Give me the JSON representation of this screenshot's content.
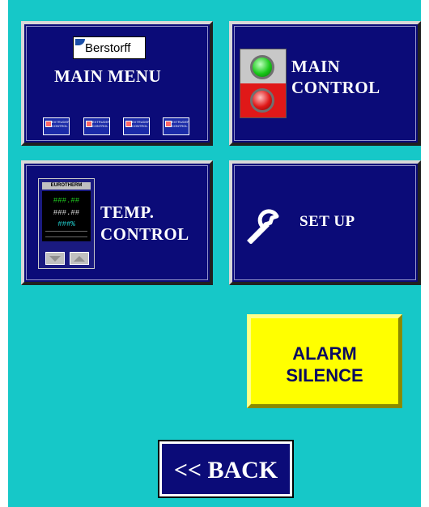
{
  "main_menu": {
    "label": "MAIN MENU",
    "logo_text": "Berstorff",
    "mini_icon_label": "EXTRUDER CONTROL"
  },
  "main_control": {
    "label_line1": "MAIN",
    "label_line2": "CONTROL"
  },
  "temp_control": {
    "label_line1": "TEMP.",
    "label_line2": "CONTROL",
    "controller_brand": "EUROTHERM",
    "pv": "###.##",
    "sp": "###.##",
    "out": "###%"
  },
  "set_up": {
    "label": "SET UP"
  },
  "alarm": {
    "label_line1": "ALARM",
    "label_line2": "SILENCE",
    "color": "#ffff00"
  },
  "back": {
    "label": "<< BACK"
  },
  "colors": {
    "background": "#16c8c8",
    "tile": "#0b0b78",
    "pv_text": "#22d822",
    "out_text": "#22d8d8"
  }
}
